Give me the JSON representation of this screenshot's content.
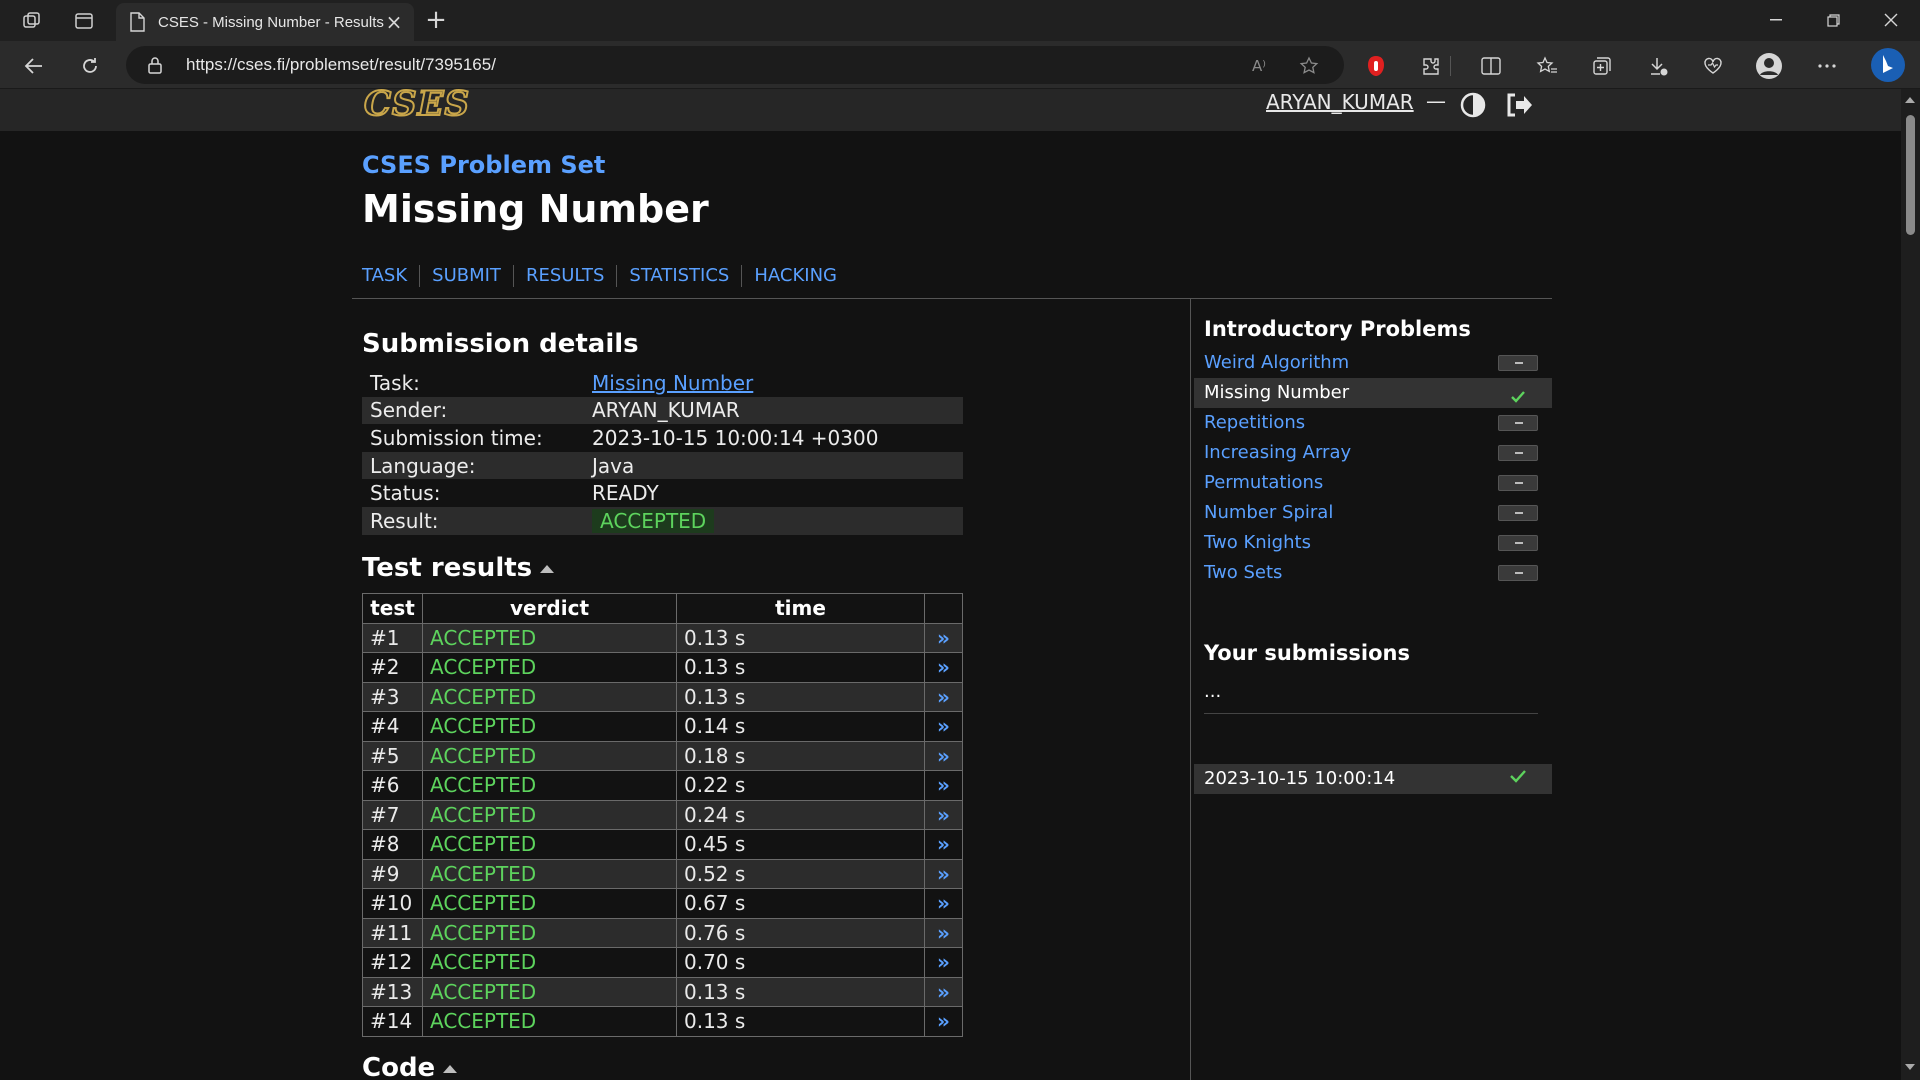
{
  "browser": {
    "tab_title": "CSES - Missing Number - Results",
    "tab_close": "×",
    "new_tab": "+",
    "url": "https://cses.fi/problemset/result/7395165/",
    "read_aloud": "A⁾"
  },
  "site": {
    "logo_text": "CSES",
    "user": "ARYAN_KUMAR",
    "user_dash": "—"
  },
  "page": {
    "breadcrumb": "CSES Problem Set",
    "title": "Missing Number",
    "nav": [
      "TASK",
      "SUBMIT",
      "RESULTS",
      "STATISTICS",
      "HACKING"
    ]
  },
  "submission": {
    "heading": "Submission details",
    "rows": [
      {
        "label": "Task:",
        "value": "Missing Number"
      },
      {
        "label": "Sender:",
        "value": "ARYAN_KUMAR"
      },
      {
        "label": "Submission time:",
        "value": "2023-10-15 10:00:14 +0300"
      },
      {
        "label": "Language:",
        "value": "Java"
      },
      {
        "label": "Status:",
        "value": "READY"
      },
      {
        "label": "Result:",
        "value": "ACCEPTED"
      }
    ]
  },
  "tests": {
    "heading": "Test results",
    "columns": [
      "test",
      "verdict",
      "time"
    ],
    "arrow": "»",
    "rows": [
      {
        "test": "#1",
        "verdict": "ACCEPTED",
        "time": "0.13 s"
      },
      {
        "test": "#2",
        "verdict": "ACCEPTED",
        "time": "0.13 s"
      },
      {
        "test": "#3",
        "verdict": "ACCEPTED",
        "time": "0.13 s"
      },
      {
        "test": "#4",
        "verdict": "ACCEPTED",
        "time": "0.14 s"
      },
      {
        "test": "#5",
        "verdict": "ACCEPTED",
        "time": "0.18 s"
      },
      {
        "test": "#6",
        "verdict": "ACCEPTED",
        "time": "0.22 s"
      },
      {
        "test": "#7",
        "verdict": "ACCEPTED",
        "time": "0.24 s"
      },
      {
        "test": "#8",
        "verdict": "ACCEPTED",
        "time": "0.45 s"
      },
      {
        "test": "#9",
        "verdict": "ACCEPTED",
        "time": "0.52 s"
      },
      {
        "test": "#10",
        "verdict": "ACCEPTED",
        "time": "0.67 s"
      },
      {
        "test": "#11",
        "verdict": "ACCEPTED",
        "time": "0.76 s"
      },
      {
        "test": "#12",
        "verdict": "ACCEPTED",
        "time": "0.70 s"
      },
      {
        "test": "#13",
        "verdict": "ACCEPTED",
        "time": "0.13 s"
      },
      {
        "test": "#14",
        "verdict": "ACCEPTED",
        "time": "0.13 s"
      }
    ]
  },
  "code": {
    "heading": "Code"
  },
  "sidebar": {
    "heading": "Introductory Problems",
    "items": [
      {
        "label": "Weird Algorithm",
        "status": "not-attempted"
      },
      {
        "label": "Missing Number",
        "status": "solved"
      },
      {
        "label": "Repetitions",
        "status": "not-attempted"
      },
      {
        "label": "Increasing Array",
        "status": "not-attempted"
      },
      {
        "label": "Permutations",
        "status": "not-attempted"
      },
      {
        "label": "Number Spiral",
        "status": "not-attempted"
      },
      {
        "label": "Two Knights",
        "status": "not-attempted"
      },
      {
        "label": "Two Sets",
        "status": "not-attempted"
      }
    ],
    "ellipsis": "...",
    "submissions_heading": "Your submissions",
    "submissions": [
      {
        "time": "2023-10-15 10:00:14",
        "status": "accepted"
      }
    ]
  },
  "colors": {
    "accent": "#5aa0ff",
    "accepted": "#5dd35d",
    "logo": "#c9a64a",
    "background": "#121212"
  }
}
